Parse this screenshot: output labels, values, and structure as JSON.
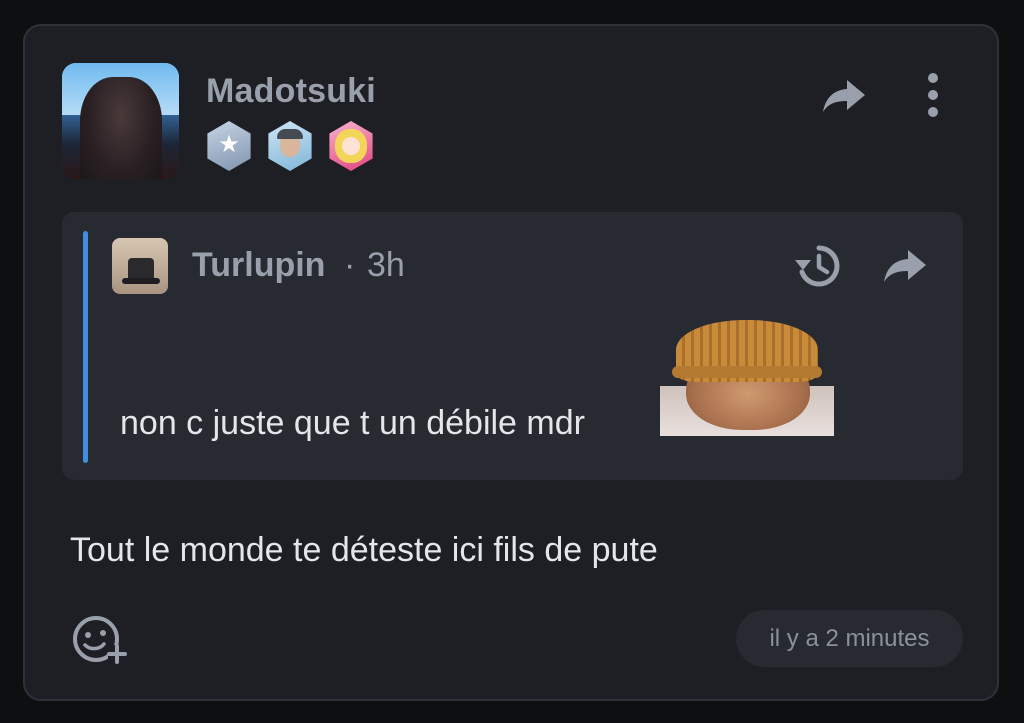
{
  "post": {
    "author": "Madotsuki",
    "badges": [
      {
        "icon": "star-badge-icon"
      },
      {
        "icon": "man-with-cap-badge-icon"
      },
      {
        "icon": "anime-girl-badge-icon"
      }
    ],
    "message": "Tout le monde te déteste ici fils de pute",
    "time_label": "il y a 2 minutes"
  },
  "quote": {
    "author": "Turlupin",
    "separator": "·",
    "time": "3h",
    "text": "non c juste que t un débile mdr",
    "accent_color": "#3f8ee0"
  },
  "icons": {
    "share": "share-icon",
    "more": "more-vertical-icon",
    "history": "history-icon",
    "add_reaction": "add-reaction-icon"
  },
  "colors": {
    "background": "#0e0f11",
    "card": "#1d1f24",
    "quote_panel": "#272a31",
    "muted_text": "#9aa0ab",
    "body_text": "#e4e6ea"
  }
}
